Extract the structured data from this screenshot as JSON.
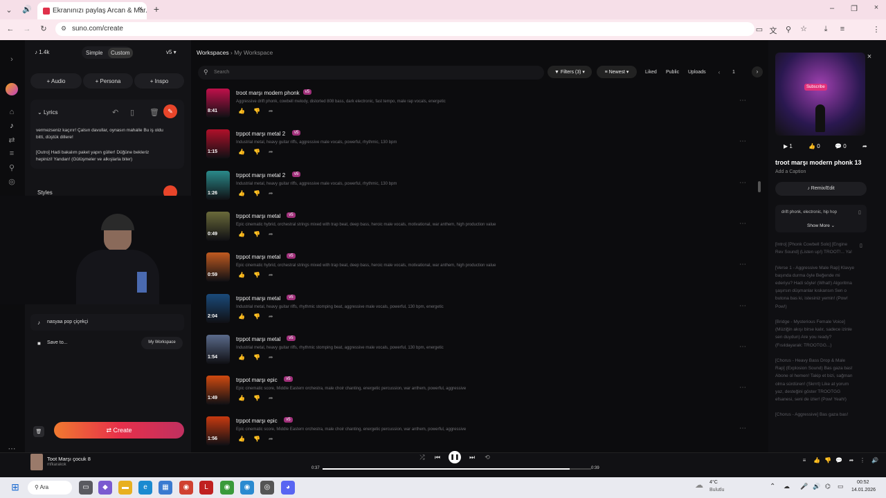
{
  "browser": {
    "tab_title": "Ekranınızı paylaş Arcan & Mar...",
    "url": "suno.com/create"
  },
  "left_panel": {
    "credits": "1.4k",
    "mode_simple": "Simple",
    "mode_custom": "Custom",
    "version": "v5",
    "add_audio": "Audio",
    "add_persona": "Persona",
    "add_inspo": "Inspo",
    "lyrics_label": "Lyrics",
    "lyrics_text_1": "vermezseniz kaçırır! Çalsın davullar, oynasın mahalle Bu iş oldu bitti, düştük dillere!",
    "lyrics_text_2": "[Outro] Hadi bakalım paket yapın güller! Düğüne bekleriz hepinizi! Yandan! (Gülüşmeler ve alkışlarla biter)",
    "styles_label": "Styles",
    "song_title": "nasyaa pop çiçekçi",
    "save_to": "Save to...",
    "workspace_btn": "My Workspace",
    "create_btn": "Create"
  },
  "main": {
    "breadcrumb_root": "Workspaces",
    "breadcrumb_current": "My Workspace",
    "search_placeholder": "Search",
    "filters": "Filters (3)",
    "sort": "Newest",
    "liked": "Liked",
    "public": "Public",
    "uploads": "Uploads",
    "page": "1",
    "songs": [
      {
        "title": "troot marşı modern phonk",
        "badge": "v5",
        "tags": "Aggressive drift phonk, cowbell melody, distorted 808 bass, dark electronic, fast tempo, male rap vocals, energetic",
        "duration": "8:41",
        "color": "#c0104a"
      },
      {
        "title": "trppot marşı metal 2",
        "badge": "v5",
        "tags": "Industrial metal, heavy guitar riffs, aggressive male vocals, powerful, rhythmic, 130 bpm",
        "duration": "1:15",
        "color": "#b0102a"
      },
      {
        "title": "trppot marşı metal 2",
        "badge": "v5",
        "tags": "Industrial metal, heavy guitar riffs, aggressive male vocals, powerful, rhythmic, 130 bpm",
        "duration": "1:26",
        "color": "#2a8a8a"
      },
      {
        "title": "trppot marşı metal",
        "badge": "v5",
        "tags": "Epic cinematic hybrid, orchestral strings mixed with trap beat, deep bass, heroic male vocals, motivational, war anthem, high production value",
        "duration": "0:49",
        "color": "#6a6a3a"
      },
      {
        "title": "trppot marşı metal",
        "badge": "v5",
        "tags": "Epic cinematic hybrid, orchestral strings mixed with trap beat, deep bass, heroic male vocals, motivational, war anthem, high production value",
        "duration": "0:59",
        "color": "#c05a20"
      },
      {
        "title": "trppot marşı metal",
        "badge": "v5",
        "tags": "Industrial metal, heavy guitar riffs, rhythmic stomping beat, aggressive male vocals, powerful, 130 bpm, energetic",
        "duration": "2:04",
        "color": "#1a4a7a"
      },
      {
        "title": "trppot marşı metal",
        "badge": "v5",
        "tags": "Industrial metal, heavy guitar riffs, rhythmic stomping beat, aggressive male vocals, powerful, 130 bpm, energetic",
        "duration": "1:54",
        "color": "#5a6a8a"
      },
      {
        "title": "trppot marşı epic",
        "badge": "v5",
        "tags": "Epic cinematic score, Middle Eastern orchestra, male choir chanting, energetic percussion, war anthem, powerful, aggressive",
        "duration": "1:49",
        "color": "#d04a10"
      },
      {
        "title": "trppot marşı epic",
        "badge": "v5",
        "tags": "Epic cinematic score, Middle Eastern orchestra, male choir chanting, energetic percussion, war anthem, powerful, aggressive",
        "duration": "1:56",
        "color": "#c83a10"
      }
    ]
  },
  "right_panel": {
    "thumb_caption": "Subscribe",
    "plays": "1",
    "likes": "0",
    "comments": "0",
    "title": "troot marşı modern phonk 13",
    "caption": "Add a Caption",
    "remix": "Remix/Edit",
    "tags": "drift phonk, electronic, hip hop",
    "show_more": "Show More",
    "lyrics": "[Intro] [Phonk Cowbell Solo] [Engine Rev Sound] (Listen up!) TROOT!... Ya!\n\n[Verse 1 - Aggressive Male Rap] Klavye başında durma öyle Beğende mi ederiyu? Hadi söyle! (What!) Algoritma şaşırsın düşmanlar kıskansın Sen o butona bas ki, istesiniz yemin! (Pow! Pow!)\n\n[Bridge - Mysterious Female Voice] (Müziğin akışı birse kalır, sadece izinle sen duydun) Are you ready? (Fısıldayarak: TROOTGG...)\n\n[Chorus - Heavy Bass Drop & Male Rap] (Explosion Sound) Bas gaza bas! Abone ol hemen! Takip et bizi, sağman olma sürdüren! (Skrrrt) Like at yorum yaz, desteğini göster TROOTGG efsanesi, seni de izler! (Pow! Yeah!)\n\n[Chorus - Aggressive] Bas gaza bas!"
  },
  "player": {
    "title": "Toot Marşı çocuk 8",
    "artist": "mfkarakok",
    "elapsed": "0:37",
    "total": "0:39",
    "progress": 0.92
  },
  "taskbar": {
    "search": "Ara",
    "weather_temp": "4°C",
    "weather_desc": "Bulutlu",
    "time": "00:52",
    "date": "14.01.2026"
  }
}
